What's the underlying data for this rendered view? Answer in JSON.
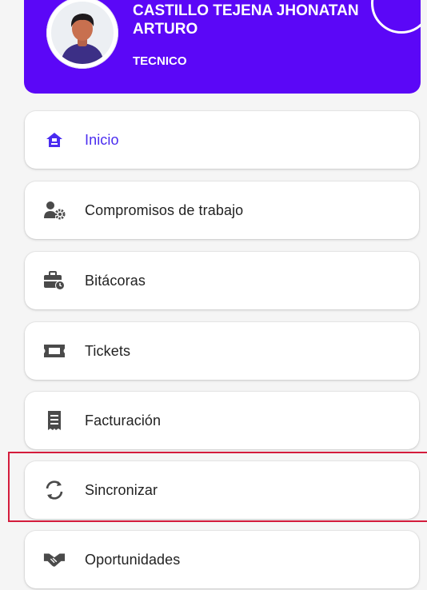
{
  "profile": {
    "name": "CASTILLO TEJENA JHONATAN ARTURO",
    "role": "TECNICO"
  },
  "menu": [
    {
      "label": "Inicio",
      "icon": "home-icon",
      "active": true
    },
    {
      "label": "Compromisos de trabajo",
      "icon": "user-gear-icon",
      "active": false
    },
    {
      "label": "Bitácoras",
      "icon": "briefcase-clock-icon",
      "active": false
    },
    {
      "label": "Tickets",
      "icon": "ticket-icon",
      "active": false
    },
    {
      "label": "Facturación",
      "icon": "receipt-icon",
      "active": false
    },
    {
      "label": "Sincronizar",
      "icon": "sync-icon",
      "active": false
    },
    {
      "label": "Oportunidades",
      "icon": "handshake-icon",
      "active": false
    }
  ],
  "colors": {
    "header_bg": "#5b07f7",
    "active_accent": "#4a2cf0",
    "icon_gray": "#4a4a4a",
    "highlight_border": "#d41c3c"
  }
}
